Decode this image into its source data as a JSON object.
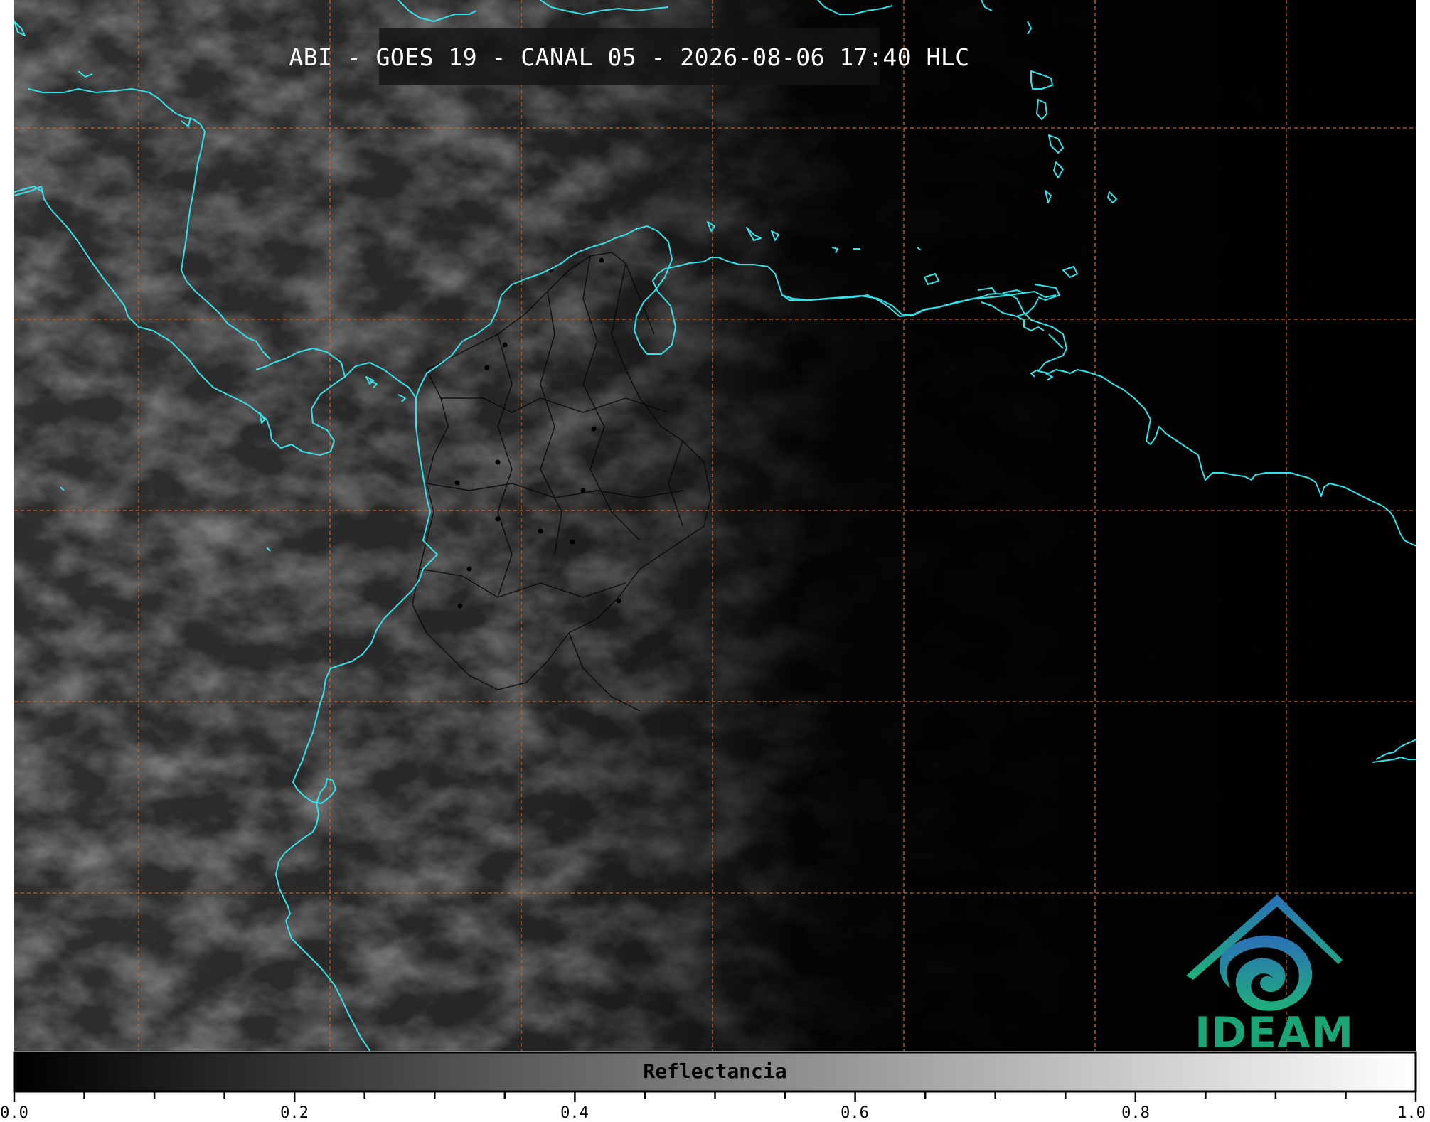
{
  "title": "ABI - GOES 19 - CANAL 05 - 2026-08-06 17:40 HLC",
  "colorbar": {
    "label": "Reflectancia",
    "tick_labels": [
      "0.0",
      "0.2",
      "0.4",
      "0.6",
      "0.8",
      "1.0"
    ],
    "range": [
      0.0,
      1.0
    ],
    "colormap": [
      "#000000",
      "#ffffff"
    ]
  },
  "logo": {
    "text": "IDEAM"
  },
  "colors": {
    "coastline": "#36e0e6",
    "gridlines": "#c8642a",
    "borders": "#000000",
    "background": "#0a0a0a",
    "logo_blue": "#2b74b8",
    "logo_green": "#1aa574"
  }
}
